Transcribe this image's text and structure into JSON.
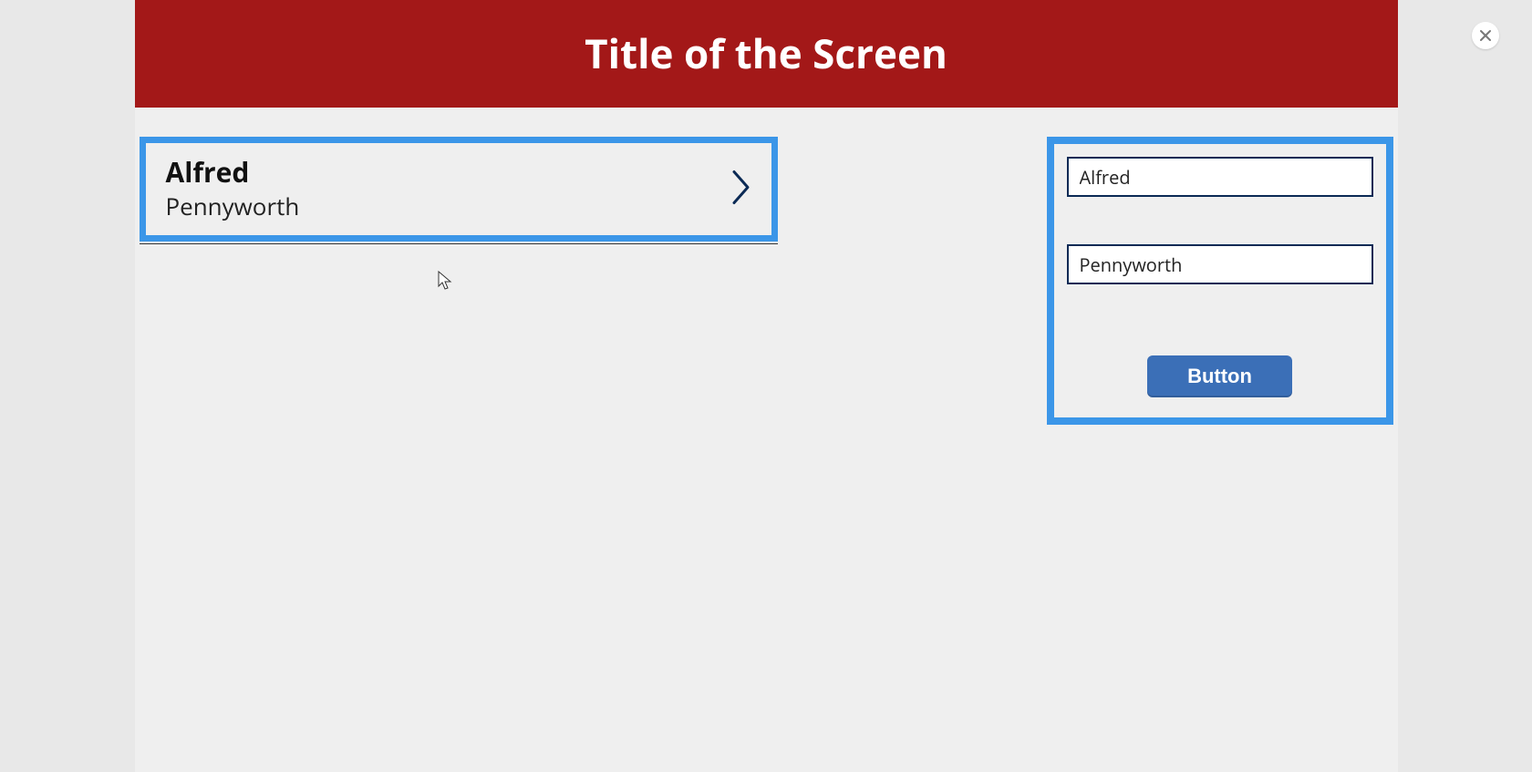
{
  "header": {
    "title": "Title of the Screen"
  },
  "list": {
    "items": [
      {
        "primary": "Alfred",
        "secondary": "Pennyworth"
      }
    ]
  },
  "form": {
    "field1": "Alfred",
    "field2": "Pennyworth",
    "button_label": "Button"
  }
}
